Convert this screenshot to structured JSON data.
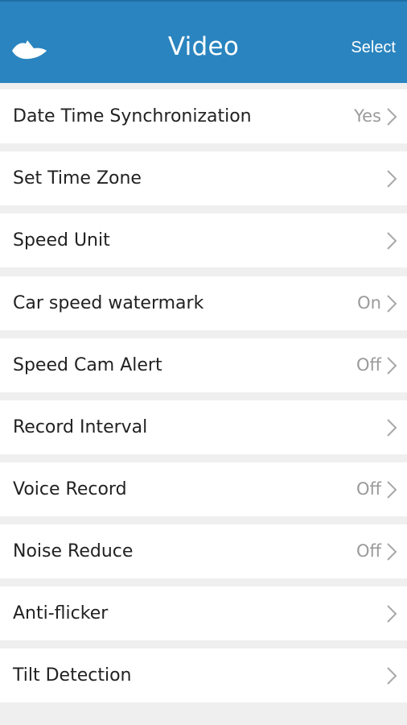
{
  "header": {
    "title": "Video",
    "select_label": "Select",
    "back_icon": "back-arrow-icon",
    "bar_color": "#2a84bf"
  },
  "settings": [
    {
      "label": "Date Time Synchronization",
      "value": "Yes"
    },
    {
      "label": "Set Time Zone",
      "value": ""
    },
    {
      "label": "Speed Unit",
      "value": ""
    },
    {
      "label": "Car speed watermark",
      "value": "On"
    },
    {
      "label": "Speed Cam Alert",
      "value": "Off"
    },
    {
      "label": "Record Interval",
      "value": ""
    },
    {
      "label": "Voice Record",
      "value": "Off"
    },
    {
      "label": "Noise Reduce",
      "value": "Off"
    },
    {
      "label": "Anti-flicker",
      "value": ""
    },
    {
      "label": "Tilt Detection",
      "value": ""
    }
  ],
  "icons": {
    "row_chevron": "chevron-right-icon"
  }
}
